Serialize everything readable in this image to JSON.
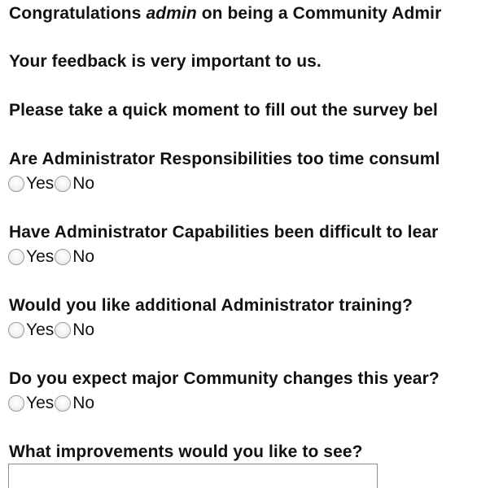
{
  "intro": {
    "congrats_prefix": "Congratulations ",
    "username": "admin",
    "congrats_suffix": " on being a Community Admir",
    "feedback": "Your feedback is very important to us.",
    "instructions": "Please take a quick moment to fill out the survey bel"
  },
  "questions": [
    {
      "text": "Are Administrator Responsibilities too time consuml",
      "options": [
        "Yes",
        "No"
      ]
    },
    {
      "text": "Have Administrator Capabilities been difficult to lear",
      "options": [
        "Yes",
        "No"
      ]
    },
    {
      "text": "Would you like additional Administrator training?",
      "options": [
        "Yes",
        "No"
      ]
    },
    {
      "text": "Do you expect major Community changes this year?",
      "options": [
        "Yes",
        "No"
      ]
    }
  ],
  "improvements": {
    "label": "What improvements would you like to see?",
    "value": ""
  },
  "colors": {
    "text": "#111111",
    "background": "#ffffff",
    "radio_border": "#9a9a9a",
    "textarea_border": "#8c8c8c"
  }
}
